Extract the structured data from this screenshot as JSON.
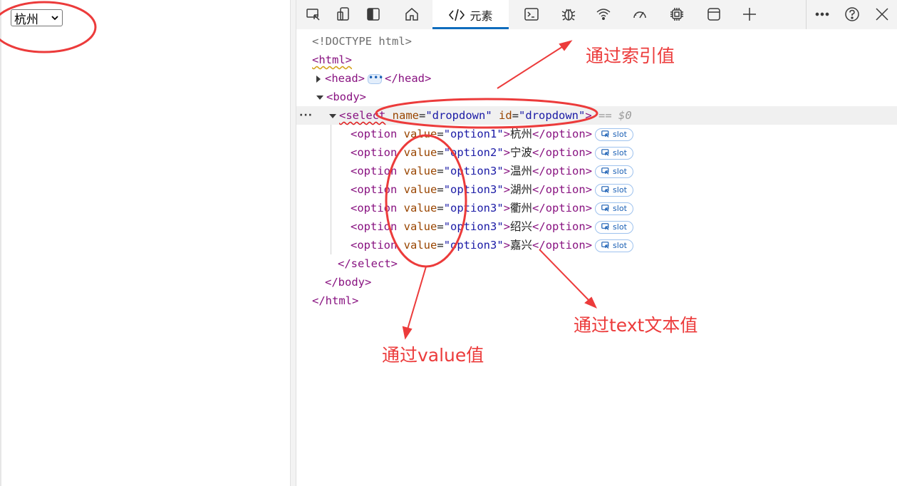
{
  "page": {
    "select_value": "杭州"
  },
  "toolbar": {
    "tab_elements_label": "元素",
    "icons": [
      "inspect-icon",
      "device-emulation-icon",
      "dock-icon",
      "welcome-home-icon",
      "elements-code-icon",
      "console-icon",
      "sources-bug-icon",
      "network-wifi-icon",
      "performance-gauge-icon",
      "memory-chip-icon",
      "application-window-icon",
      "more-tools-plus-icon",
      "more-options-icon",
      "help-icon",
      "close-icon"
    ]
  },
  "dom": {
    "doctype": "<!DOCTYPE html>",
    "html_open": "<html>",
    "head_open": "<head>",
    "head_close": "</head>",
    "body_open": "<body>",
    "select_tag_open": "<select",
    "select_attr_name": "name",
    "select_attr_name_value": "\"dropdown\"",
    "select_attr_id": "id",
    "select_attr_id_value": "\"dropdown\"",
    "select_tag_end": ">",
    "selected_marker": "== $0",
    "options": [
      {
        "value": "\"option1\"",
        "text": "杭州"
      },
      {
        "value": "\"option2\"",
        "text": "宁波"
      },
      {
        "value": "\"option3\"",
        "text": "温州"
      },
      {
        "value": "\"option3\"",
        "text": "湖州"
      },
      {
        "value": "\"option3\"",
        "text": "衢州"
      },
      {
        "value": "\"option3\"",
        "text": "绍兴"
      },
      {
        "value": "\"option3\"",
        "text": "嘉兴"
      }
    ],
    "option_open": "<option",
    "option_attr": "value",
    "option_close": "</option>",
    "slot_label": "slot",
    "select_close": "</select>",
    "body_close": "</body>",
    "html_close": "</html>"
  },
  "annotations": {
    "index_label": "通过索引值",
    "text_label": "通过text文本值",
    "value_label": "通过value值"
  },
  "colors": {
    "annotation_red": "#ec3b3b",
    "accent_blue": "#0f6cbd"
  }
}
